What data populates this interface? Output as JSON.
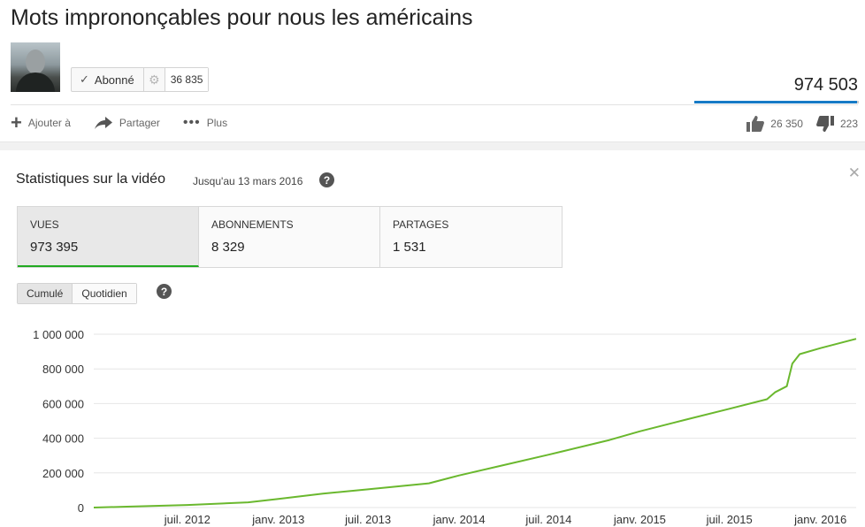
{
  "video": {
    "title": "Mots imprononçables pour nous les américains",
    "subscribe_label": "Abonné",
    "subscriber_count": "36 835",
    "view_count": "974 503",
    "like_ratio": 0.99
  },
  "actions": {
    "add_to": "Ajouter à",
    "share": "Partager",
    "more": "Plus",
    "likes": "26 350",
    "dislikes": "223"
  },
  "stats": {
    "title": "Statistiques sur la vidéo",
    "date": "Jusqu'au 13 mars 2016",
    "metrics": [
      {
        "label": "VUES",
        "value": "973 395"
      },
      {
        "label": "ABONNEMENTS",
        "value": "8 329"
      },
      {
        "label": "PARTAGES",
        "value": "1 531"
      }
    ],
    "toggle": {
      "cumulative": "Cumulé",
      "daily": "Quotidien"
    }
  },
  "colors": {
    "line": "#6ab82e",
    "accent": "#167ac6"
  },
  "icons": {
    "add": "plus-icon",
    "share": "share-arrow-icon",
    "more": "dots-icon",
    "like": "thumbs-up-icon",
    "dislike": "thumbs-down-icon",
    "help": "help-icon",
    "close": "close-icon",
    "subscribed": "check-icon",
    "settings": "gear-icon"
  },
  "chart_data": {
    "type": "line",
    "title": "",
    "xlabel": "",
    "ylabel": "",
    "ylim": [
      0,
      1000000
    ],
    "y_ticks": [
      0,
      200000,
      400000,
      600000,
      800000,
      1000000
    ],
    "y_tick_labels": [
      "0",
      "200 000",
      "400 000",
      "600 000",
      "800 000",
      "1 000 000"
    ],
    "x_tick_labels": [
      "juil. 2012",
      "janv. 2013",
      "juil. 2013",
      "janv. 2014",
      "juil. 2014",
      "janv. 2015",
      "juil. 2015",
      "janv. 2016"
    ],
    "x_tick_dates": [
      "2012-07-01",
      "2013-01-01",
      "2013-07-01",
      "2014-01-01",
      "2014-07-01",
      "2015-01-01",
      "2015-07-01",
      "2016-01-01"
    ],
    "xlim": [
      "2011-12-25",
      "2016-03-13"
    ],
    "grid": true,
    "series": [
      {
        "color": "#6ab82e",
        "x": [
          "2011-12-25",
          "2012-03-01",
          "2012-07-01",
          "2012-11-01",
          "2013-01-01",
          "2013-04-01",
          "2013-07-01",
          "2013-11-01",
          "2014-01-01",
          "2014-04-01",
          "2014-07-01",
          "2014-11-01",
          "2015-01-01",
          "2015-04-01",
          "2015-07-01",
          "2015-09-15",
          "2015-10-01",
          "2015-10-25",
          "2015-11-05",
          "2015-11-20",
          "2016-01-01",
          "2016-03-13"
        ],
        "y": [
          0,
          5000,
          15000,
          30000,
          50000,
          80000,
          105000,
          140000,
          185000,
          245000,
          305000,
          390000,
          440000,
          505000,
          570000,
          625000,
          665000,
          700000,
          830000,
          885000,
          920000,
          973395
        ]
      }
    ]
  }
}
